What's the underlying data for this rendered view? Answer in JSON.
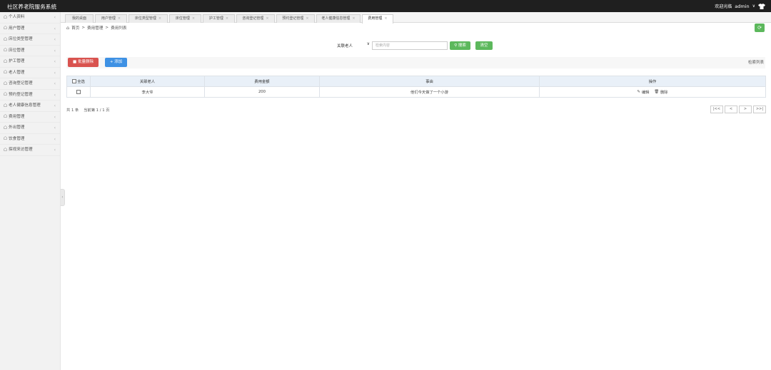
{
  "app": {
    "title": "社区养老院服务系统",
    "welcome": "欢迎光临",
    "user": "admin"
  },
  "sidebar": {
    "items": [
      {
        "label": "个人资料"
      },
      {
        "label": "用户管理"
      },
      {
        "label": "床位类型管理"
      },
      {
        "label": "床位管理"
      },
      {
        "label": "护工管理"
      },
      {
        "label": "老人管理"
      },
      {
        "label": "咨询登记管理"
      },
      {
        "label": "预约登记管理"
      },
      {
        "label": "老人健康信息管理"
      },
      {
        "label": "费用管理"
      },
      {
        "label": "外出管理"
      },
      {
        "label": "饮食管理"
      },
      {
        "label": "探视来访管理"
      }
    ]
  },
  "tabs": [
    {
      "label": "我的桌面"
    },
    {
      "label": "用户管理"
    },
    {
      "label": "床位类型管理"
    },
    {
      "label": "床位管理"
    },
    {
      "label": "护工管理"
    },
    {
      "label": "咨询登记管理"
    },
    {
      "label": "预约登记管理"
    },
    {
      "label": "老人健康信息管理"
    },
    {
      "label": "费用管理"
    }
  ],
  "breadcrumb": {
    "home": "首页",
    "section": "费用管理",
    "page": "费用列表"
  },
  "search": {
    "select_value": "关联老人",
    "placeholder": "检索内容",
    "search_label": "搜索",
    "clear_label": "清空"
  },
  "actions": {
    "batch_delete": "批量删除",
    "add": "添加",
    "list_label": "检索列表"
  },
  "table": {
    "headers": {
      "select_all": "全选",
      "elder": "关联老人",
      "amount": "费用金额",
      "reason": "事由",
      "ops": "操作"
    },
    "rows": [
      {
        "elder": "李大爷",
        "amount": "200",
        "reason": "他们今天做了一个小游",
        "edit": "编辑",
        "delete": "删除"
      }
    ]
  },
  "footer": {
    "total": "共 1 条",
    "page_info": "当前第 1 / 1 页",
    "first": "|<<",
    "prev": "<",
    "next": ">",
    "last": ">>|"
  },
  "colors": {
    "topbar": "#1f1f1f",
    "success": "#5cb85c",
    "danger": "#d9534f",
    "primary": "#3e91e4"
  }
}
